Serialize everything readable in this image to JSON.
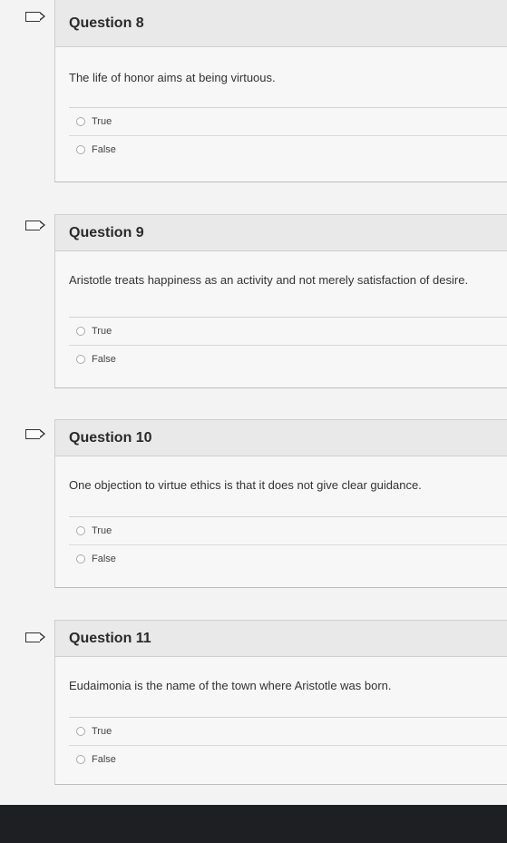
{
  "questions": [
    {
      "title": "Question 8",
      "text": "The life of honor aims at being virtuous.",
      "options": [
        "True",
        "False"
      ]
    },
    {
      "title": "Question 9",
      "text": "Aristotle treats happiness as an activity and not merely satisfaction of desire.",
      "options": [
        "True",
        "False"
      ]
    },
    {
      "title": "Question 10",
      "text": "One objection to virtue ethics is that it does not give clear guidance.",
      "options": [
        "True",
        "False"
      ]
    },
    {
      "title": "Question 11",
      "text": "Eudaimonia is the name of the town where Aristotle was born.",
      "options": [
        "True",
        "False"
      ]
    }
  ],
  "icons": {
    "flag": "flag-icon",
    "radio": "radio-button-icon"
  }
}
